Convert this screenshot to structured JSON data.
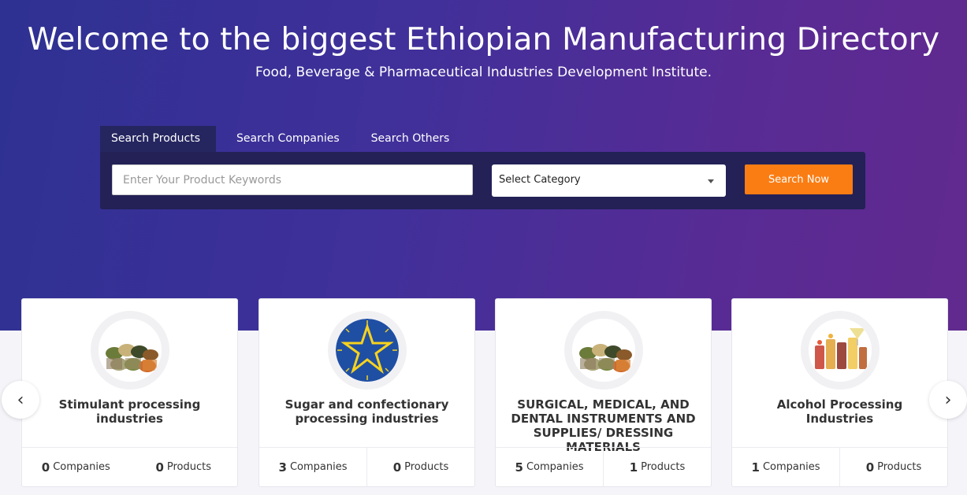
{
  "hero": {
    "title": "Welcome to the biggest Ethiopian Manufacturing Directory",
    "subtitle": "Food, Beverage & Pharmaceutical Industries Development Institute."
  },
  "search": {
    "tabs": [
      {
        "label": "Search Products",
        "active": true
      },
      {
        "label": "Search Companies",
        "active": false
      },
      {
        "label": "Search Others",
        "active": false
      }
    ],
    "keyword_placeholder": "Enter Your Product Keywords",
    "keyword_value": "",
    "category_selected": "Select Category",
    "button_label": "Search Now"
  },
  "carousel": {
    "prev_icon": "‹",
    "next_icon": "›",
    "cards": [
      {
        "title": "Stimulant processing industries",
        "icon": "grains-icon",
        "companies": "0",
        "companies_label": "Companies",
        "products": "0",
        "products_label": "Products"
      },
      {
        "title": "Sugar and confectionary processing industries",
        "icon": "ethiopia-emblem-icon",
        "companies": "3",
        "companies_label": "Companies",
        "products": "0",
        "products_label": "Products"
      },
      {
        "title": "SURGICAL, MEDICAL, AND DENTAL INSTRUMENTS AND SUPPLIES/ DRESSING MATERIALS",
        "icon": "grains-icon",
        "companies": "5",
        "companies_label": "Companies",
        "products": "1",
        "products_label": "Products"
      },
      {
        "title": "Alcohol Processing Industries",
        "icon": "drinks-icon",
        "companies": "1",
        "companies_label": "Companies",
        "products": "0",
        "products_label": "Products"
      }
    ]
  },
  "colors": {
    "hero_start": "#2e3192",
    "hero_end": "#612a8f",
    "search_panel": "#232156",
    "accent_button": "#fa7d14"
  }
}
